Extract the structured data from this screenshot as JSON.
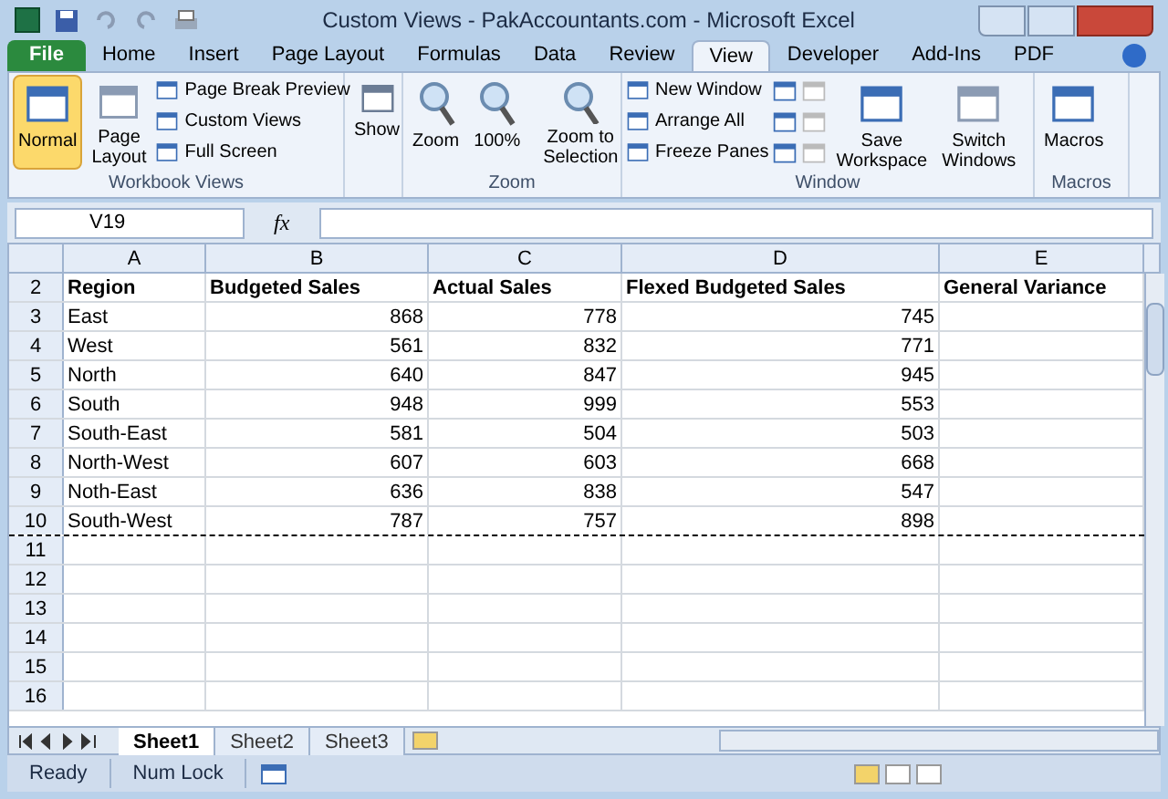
{
  "window": {
    "title": "Custom Views - PakAccountants.com  -  Microsoft Excel"
  },
  "ribbon_tabs": [
    {
      "label": "File",
      "kind": "file",
      "selected": false
    },
    {
      "label": "Home",
      "kind": "tab",
      "selected": false
    },
    {
      "label": "Insert",
      "kind": "tab",
      "selected": false
    },
    {
      "label": "Page Layout",
      "kind": "tab",
      "selected": false
    },
    {
      "label": "Formulas",
      "kind": "tab",
      "selected": false
    },
    {
      "label": "Data",
      "kind": "tab",
      "selected": false
    },
    {
      "label": "Review",
      "kind": "tab",
      "selected": false
    },
    {
      "label": "View",
      "kind": "tab",
      "selected": true
    },
    {
      "label": "Developer",
      "kind": "tab",
      "selected": false
    },
    {
      "label": "Add-Ins",
      "kind": "tab",
      "selected": false
    },
    {
      "label": "PDF",
      "kind": "tab",
      "selected": false
    }
  ],
  "workbook_views": {
    "label": "Workbook Views",
    "normal": {
      "label": "Normal",
      "selected": true
    },
    "page_layout": {
      "label": "Page Layout",
      "selected": false
    },
    "small": [
      "Page Break Preview",
      "Custom Views",
      "Full Screen"
    ]
  },
  "show": {
    "label": "Show"
  },
  "zoom": {
    "label": "Zoom",
    "buttons": [
      "Zoom",
      "100%",
      "Zoom to Selection"
    ]
  },
  "window_group": {
    "label": "Window",
    "small": [
      "New Window",
      "Arrange All",
      "Freeze Panes"
    ],
    "save": "Save Workspace",
    "switch": "Switch Windows"
  },
  "macros": {
    "label": "Macros",
    "button": "Macros"
  },
  "name_box": "V19",
  "formula_icon": "fx",
  "columns": [
    "A",
    "B",
    "C",
    "D",
    "E"
  ],
  "rows": [
    {
      "num": "2",
      "kind": "header",
      "page_break": false,
      "cells": [
        "Region",
        "Budgeted Sales",
        "Actual Sales",
        "Flexed Budgeted Sales",
        "General Variance"
      ]
    },
    {
      "num": "3",
      "kind": "data",
      "page_break": false,
      "cells": [
        "East",
        "868",
        "778",
        "745"
      ]
    },
    {
      "num": "4",
      "kind": "data",
      "page_break": false,
      "cells": [
        "West",
        "561",
        "832",
        "771"
      ]
    },
    {
      "num": "5",
      "kind": "data",
      "page_break": false,
      "cells": [
        "North",
        "640",
        "847",
        "945"
      ]
    },
    {
      "num": "6",
      "kind": "data",
      "page_break": false,
      "cells": [
        "South",
        "948",
        "999",
        "553"
      ]
    },
    {
      "num": "7",
      "kind": "data",
      "page_break": false,
      "cells": [
        "South-East",
        "581",
        "504",
        "503"
      ]
    },
    {
      "num": "8",
      "kind": "data",
      "page_break": false,
      "cells": [
        "North-West",
        "607",
        "603",
        "668"
      ]
    },
    {
      "num": "9",
      "kind": "data",
      "page_break": false,
      "cells": [
        "Noth-East",
        "636",
        "838",
        "547"
      ]
    },
    {
      "num": "10",
      "kind": "data",
      "page_break": true,
      "cells": [
        "South-West",
        "787",
        "757",
        "898"
      ]
    },
    {
      "num": "11",
      "kind": "data",
      "page_break": false,
      "cells": []
    },
    {
      "num": "12",
      "kind": "data",
      "page_break": false,
      "cells": []
    },
    {
      "num": "13",
      "kind": "data",
      "page_break": false,
      "cells": []
    },
    {
      "num": "14",
      "kind": "data",
      "page_break": false,
      "cells": []
    },
    {
      "num": "15",
      "kind": "data",
      "page_break": false,
      "cells": []
    },
    {
      "num": "16",
      "kind": "data",
      "page_break": false,
      "cells": []
    }
  ],
  "sheets": [
    {
      "label": "Sheet1",
      "selected": true
    },
    {
      "label": "Sheet2",
      "selected": false
    },
    {
      "label": "Sheet3",
      "selected": false
    }
  ],
  "status_bar": [
    "Ready",
    "Num Lock"
  ]
}
